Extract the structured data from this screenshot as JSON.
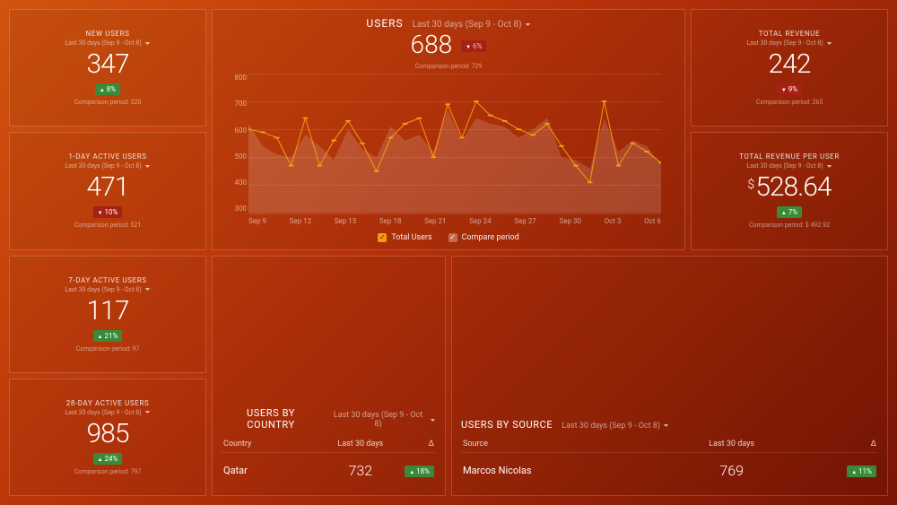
{
  "period_label": "Last 30 days (Sep 9 - Oct 8)",
  "stats": {
    "new_users": {
      "title": "NEW USERS",
      "value": "347",
      "delta": "8%",
      "dir": "up",
      "comp": "Comparison period: 320"
    },
    "day1": {
      "title": "1-DAY ACTIVE USERS",
      "value": "471",
      "delta": "10%",
      "dir": "down",
      "comp": "Comparison period: 521"
    },
    "day7": {
      "title": "7-DAY ACTIVE USERS",
      "value": "117",
      "delta": "21%",
      "dir": "up",
      "comp": "Comparison period: 97"
    },
    "day28": {
      "title": "28-DAY ACTIVE USERS",
      "value": "985",
      "delta": "24%",
      "dir": "up",
      "comp": "Comparison period: 797"
    },
    "revenue": {
      "title": "TOTAL REVENUE",
      "value": "242",
      "delta": "9%",
      "dir": "down",
      "comp": "Comparison period: 265"
    },
    "rev_per_user": {
      "title": "TOTAL REVENUE PER USER",
      "value": "528.64",
      "currency": "$",
      "delta": "7%",
      "dir": "up",
      "comp": "Comparison period: $ 492.92"
    }
  },
  "main_chart": {
    "title": "USERS",
    "value": "688",
    "delta": "6%",
    "dir": "down",
    "comp": "Comparison period: 729",
    "legend_total": "Total Users",
    "legend_compare": "Compare period"
  },
  "chart_data": {
    "type": "line",
    "title": "USERS — Last 30 days",
    "xlabel": "",
    "ylabel": "",
    "ylim": [
      300,
      800
    ],
    "x_ticks": [
      "Sep 9",
      "Sep 12",
      "Sep 15",
      "Sep 18",
      "Sep 21",
      "Sep 24",
      "Sep 27",
      "Sep 30",
      "Oct 3",
      "Oct 6"
    ],
    "x": [
      "Sep 9",
      "Sep 10",
      "Sep 11",
      "Sep 12",
      "Sep 13",
      "Sep 14",
      "Sep 15",
      "Sep 16",
      "Sep 17",
      "Sep 18",
      "Sep 19",
      "Sep 20",
      "Sep 21",
      "Sep 22",
      "Sep 23",
      "Sep 24",
      "Sep 25",
      "Sep 26",
      "Sep 27",
      "Sep 28",
      "Sep 29",
      "Sep 30",
      "Oct 1",
      "Oct 2",
      "Oct 3",
      "Oct 4",
      "Oct 5",
      "Oct 6",
      "Oct 7",
      "Oct 8"
    ],
    "series": [
      {
        "name": "Total Users",
        "values": [
          600,
          590,
          570,
          470,
          640,
          470,
          560,
          630,
          550,
          450,
          570,
          620,
          640,
          500,
          690,
          570,
          700,
          650,
          630,
          600,
          580,
          620,
          540,
          470,
          410,
          700,
          470,
          550,
          520,
          480
        ]
      },
      {
        "name": "Compare period",
        "values": [
          620,
          540,
          510,
          500,
          580,
          540,
          490,
          600,
          530,
          500,
          610,
          560,
          580,
          520,
          670,
          560,
          640,
          620,
          610,
          570,
          600,
          640,
          500,
          490,
          460,
          640,
          520,
          560,
          540,
          470
        ]
      }
    ]
  },
  "tables": {
    "by_country": {
      "title": "USERS BY COUNTRY",
      "col_a": "Country",
      "col_b": "Last 30 days",
      "col_c": "Δ",
      "row_name": "Qatar",
      "row_value": "732",
      "row_delta": "18%"
    },
    "by_source": {
      "title": "USERS BY SOURCE",
      "col_a": "Source",
      "col_b": "Last 30 days",
      "col_c": "Δ",
      "row_name": "Marcos Nicolas",
      "row_value": "769",
      "row_delta": "11%"
    }
  }
}
